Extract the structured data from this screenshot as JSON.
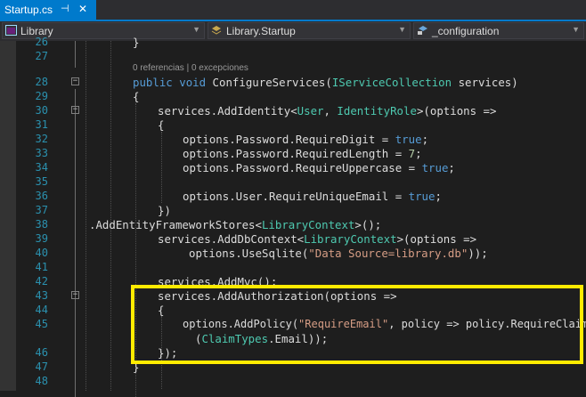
{
  "tab": {
    "title": "Startup.cs",
    "pin_glyph": "⊣",
    "close_glyph": "✕"
  },
  "nav": {
    "project": "Library",
    "class": "Library.Startup",
    "member": "_configuration",
    "dropdown_glyph": "▼"
  },
  "codelens": "0 referencias | 0 excepciones",
  "fold_glyph": "−",
  "lines": [
    {
      "n": "26",
      "t": "}"
    },
    {
      "n": "27",
      "t": ""
    },
    {
      "n": "28",
      "t": "public void ConfigureServices(IServiceCollection services)"
    },
    {
      "n": "29",
      "t": "{"
    },
    {
      "n": "30",
      "t": "services.AddIdentity<User, IdentityRole>(options =>"
    },
    {
      "n": "31",
      "t": "{"
    },
    {
      "n": "32",
      "t": "options.Password.RequireDigit = true;"
    },
    {
      "n": "33",
      "t": "options.Password.RequiredLength = 7;"
    },
    {
      "n": "34",
      "t": "options.Password.RequireUppercase = true;"
    },
    {
      "n": "35",
      "t": ""
    },
    {
      "n": "36",
      "t": "options.User.RequireUniqueEmail = true;"
    },
    {
      "n": "37",
      "t": "})"
    },
    {
      "n": "38",
      "t": ".AddEntityFrameworkStores<LibraryContext>();"
    },
    {
      "n": "39",
      "t": "services.AddDbContext<LibraryContext>(options =>"
    },
    {
      "n": "40",
      "t": "options.UseSqlite(\"Data Source=library.db\"));"
    },
    {
      "n": "41",
      "t": ""
    },
    {
      "n": "42",
      "t": "services.AddMvc();"
    },
    {
      "n": "43",
      "t": "services.AddAuthorization(options =>"
    },
    {
      "n": "44",
      "t": "{"
    },
    {
      "n": "45",
      "t": "options.AddPolicy(\"RequireEmail\", policy => policy.RequireClaim"
    },
    {
      "n": "",
      "t": "(ClaimTypes.Email));"
    },
    {
      "n": "46",
      "t": "});"
    },
    {
      "n": "47",
      "t": "}"
    },
    {
      "n": "48",
      "t": ""
    }
  ],
  "colors": {
    "accent": "#007acc",
    "highlight_box": "#ffeb00",
    "keyword": "#569cd6",
    "type": "#4ec9b0",
    "string": "#d69d85",
    "number": "#b5cea8",
    "line_number": "#2b91af"
  }
}
